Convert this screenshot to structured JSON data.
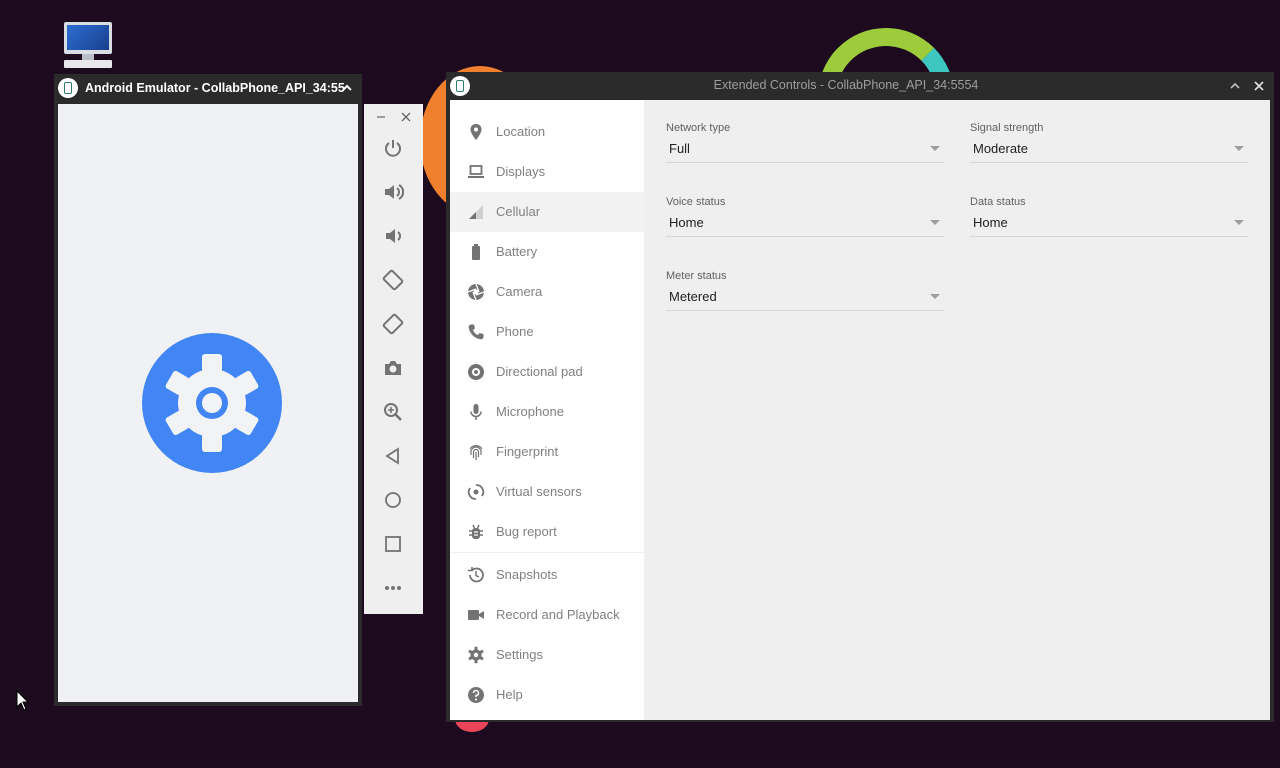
{
  "colors": {
    "desktop_bg": "#1e0a1e",
    "window_chrome": "#2b2b2b",
    "icon_grey": "#737373",
    "settings_blue": "#4285f4"
  },
  "desktop": {
    "icon": "computer-desktop-icon"
  },
  "emulator": {
    "title": "Android Emulator - CollabPhone_API_34:55",
    "screen_app_icon": "settings-gear-icon"
  },
  "toolbar": {
    "buttons": [
      "power",
      "volume-up",
      "volume-down",
      "rotate-left",
      "rotate-right",
      "screenshot",
      "zoom",
      "back",
      "home",
      "overview",
      "more"
    ]
  },
  "extended_controls": {
    "title": "Extended Controls - CollabPhone_API_34:5554",
    "nav": [
      {
        "label": "Location",
        "icon": "location-pin-icon"
      },
      {
        "label": "Displays",
        "icon": "laptop-icon"
      },
      {
        "label": "Cellular",
        "icon": "cellular-signal-icon",
        "active": true
      },
      {
        "label": "Battery",
        "icon": "battery-icon"
      },
      {
        "label": "Camera",
        "icon": "camera-aperture-icon"
      },
      {
        "label": "Phone",
        "icon": "phone-icon"
      },
      {
        "label": "Directional pad",
        "icon": "dpad-icon"
      },
      {
        "label": "Microphone",
        "icon": "microphone-icon"
      },
      {
        "label": "Fingerprint",
        "icon": "fingerprint-icon"
      },
      {
        "label": "Virtual sensors",
        "icon": "sensors-icon"
      },
      {
        "label": "Bug report",
        "icon": "bug-icon"
      },
      {
        "label": "Snapshots",
        "icon": "history-icon"
      },
      {
        "label": "Record and Playback",
        "icon": "videocam-icon"
      },
      {
        "label": "Settings",
        "icon": "gear-icon"
      },
      {
        "label": "Help",
        "icon": "help-icon"
      }
    ],
    "cellular": {
      "network_type": {
        "label": "Network type",
        "value": "Full"
      },
      "signal_strength": {
        "label": "Signal strength",
        "value": "Moderate"
      },
      "voice_status": {
        "label": "Voice status",
        "value": "Home"
      },
      "data_status": {
        "label": "Data status",
        "value": "Home"
      },
      "meter_status": {
        "label": "Meter status",
        "value": "Metered"
      }
    }
  }
}
